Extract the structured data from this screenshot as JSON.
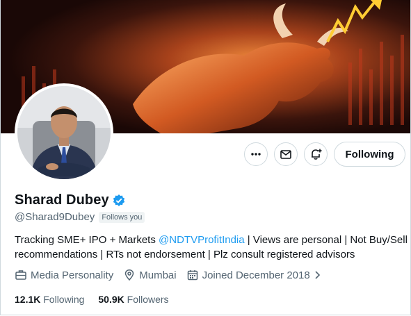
{
  "profile": {
    "name": "Sharad Dubey",
    "handle": "@Sharad9Dubey",
    "follows_you": "Follows you",
    "bio_prefix": "Tracking SME+ IPO + Markets ",
    "bio_mention": "@NDTVProfitIndia",
    "bio_suffix": " | Views are personal | Not Buy/Sell recommendations | RTs not endorsement | Plz consult registered advisors",
    "category": "Media Personality",
    "location": "Mumbai",
    "joined": "Joined December 2018",
    "following_count": "12.1K",
    "following_label": "Following",
    "followers_count": "50.9K",
    "followers_label": "Followers",
    "verified_icon": "verified-badge-icon"
  },
  "actions": {
    "more_icon": "more-icon",
    "message_icon": "mail-icon",
    "notify_icon": "bell-plus-icon",
    "follow_label": "Following"
  },
  "colors": {
    "accent": "#1d9bf0",
    "text": "#0f1419",
    "muted": "#536471",
    "border": "#cfd9de"
  }
}
